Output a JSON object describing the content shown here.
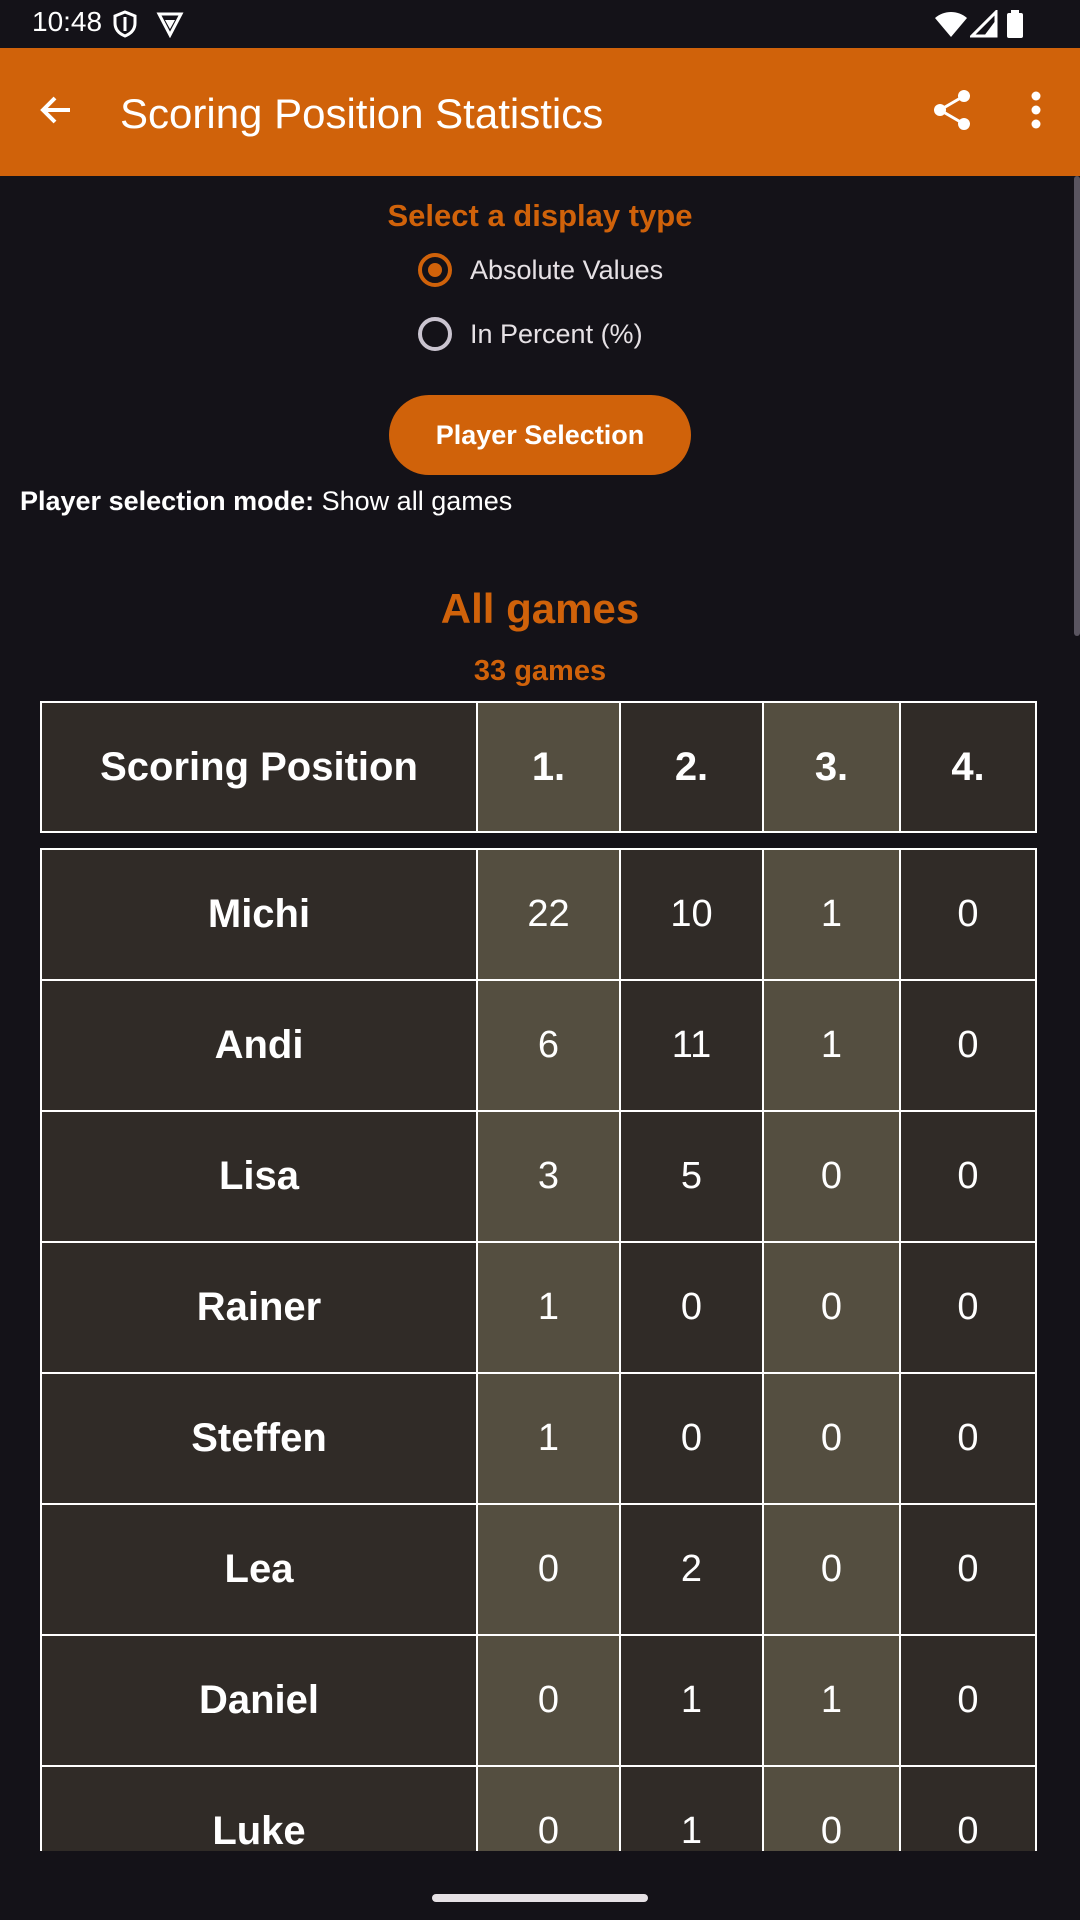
{
  "status_bar": {
    "time": "10:48"
  },
  "app_bar": {
    "title": "Scoring Position Statistics"
  },
  "display_type": {
    "title": "Select a display type",
    "options": [
      {
        "label": "Absolute Values",
        "checked": true
      },
      {
        "label": "In Percent (%)",
        "checked": false
      }
    ]
  },
  "player_selection_button": "Player Selection",
  "selection_mode": {
    "label": "Player selection mode:",
    "value": "Show all games"
  },
  "section": {
    "title": "All games",
    "subtitle": "33 games"
  },
  "table": {
    "headers": [
      "Scoring Position",
      "1.",
      "2.",
      "3.",
      "4."
    ],
    "rows": [
      {
        "name": "Michi",
        "values": [
          "22",
          "10",
          "1",
          "0"
        ]
      },
      {
        "name": "Andi",
        "values": [
          "6",
          "11",
          "1",
          "0"
        ]
      },
      {
        "name": "Lisa",
        "values": [
          "3",
          "5",
          "0",
          "0"
        ]
      },
      {
        "name": "Rainer",
        "values": [
          "1",
          "0",
          "0",
          "0"
        ]
      },
      {
        "name": "Steffen",
        "values": [
          "1",
          "0",
          "0",
          "0"
        ]
      },
      {
        "name": "Lea",
        "values": [
          "0",
          "2",
          "0",
          "0"
        ]
      },
      {
        "name": "Daniel",
        "values": [
          "0",
          "1",
          "1",
          "0"
        ]
      },
      {
        "name": "Luke",
        "values": [
          "0",
          "1",
          "0",
          "0"
        ]
      }
    ]
  },
  "colors": {
    "accent": "#d0620a",
    "background": "#141218",
    "cell_dark": "#302b27",
    "cell_light": "#544e40"
  }
}
